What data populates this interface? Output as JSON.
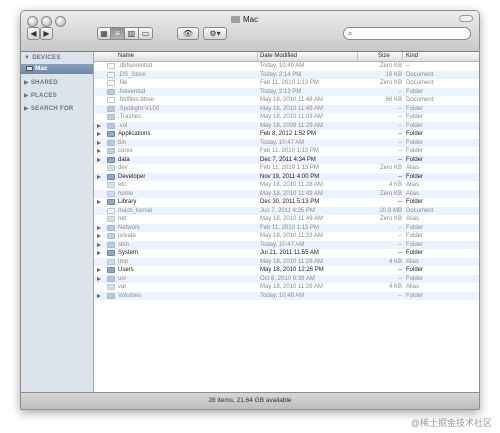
{
  "window": {
    "title": "Mac",
    "search_placeholder": "",
    "status_text": "28 items, 21.64 GB available"
  },
  "sidebar": {
    "sections": [
      {
        "label": "▼ DEVICES"
      },
      {
        "label": "▶ SHARED"
      },
      {
        "label": "▶ PLACES"
      },
      {
        "label": "▶ SEARCH FOR"
      }
    ],
    "selected_item": "Mac"
  },
  "columns": {
    "name": "Name",
    "date": "Date Modified",
    "size": "Size",
    "kind": "Kind"
  },
  "files": [
    {
      "name": ".dbfseventsd",
      "date": "Today, 10:49 AM",
      "size": "Zero KB",
      "kind": "--",
      "icon": "doc",
      "disclosure": false,
      "dim": true
    },
    {
      "name": ".DS_Store",
      "date": "Today, 2:14 PM",
      "size": "16 KB",
      "kind": "Document",
      "icon": "doc",
      "disclosure": false,
      "dim": true
    },
    {
      "name": ".file",
      "date": "Feb 11, 2010 1:13 PM",
      "size": "Zero KB",
      "kind": "Document",
      "icon": "doc",
      "disclosure": false,
      "dim": true
    },
    {
      "name": ".fseventsd",
      "date": "Today, 2:13 PM",
      "size": "--",
      "kind": "Folder",
      "icon": "folder",
      "disclosure": false,
      "dim": true
    },
    {
      "name": ".hotfiles.btree",
      "date": "May 18, 2010 11:48 AM",
      "size": "66 KB",
      "kind": "Document",
      "icon": "doc",
      "disclosure": false,
      "dim": true
    },
    {
      "name": ".Spotlight-V100",
      "date": "May 18, 2010 11:49 AM",
      "size": "--",
      "kind": "Folder",
      "icon": "folder",
      "disclosure": false,
      "dim": true
    },
    {
      "name": ".Trashes",
      "date": "May 18, 2010 11:03 AM",
      "size": "--",
      "kind": "Folder",
      "icon": "folder",
      "disclosure": false,
      "dim": true
    },
    {
      "name": ".vol",
      "date": "May 18, 2009 11:29 AM",
      "size": "--",
      "kind": "Folder",
      "icon": "folder",
      "disclosure": true,
      "dim": true
    },
    {
      "name": "Applications",
      "date": "Feb 8, 2012 1:52 PM",
      "size": "--",
      "kind": "Folder",
      "icon": "folder",
      "disclosure": true,
      "dim": false
    },
    {
      "name": "bin",
      "date": "Today, 10:47 AM",
      "size": "--",
      "kind": "Folder",
      "icon": "folder",
      "disclosure": true,
      "dim": true
    },
    {
      "name": "cores",
      "date": "Feb 11, 2010 1:13 PM",
      "size": "--",
      "kind": "Folder",
      "icon": "folder",
      "disclosure": true,
      "dim": true
    },
    {
      "name": "data",
      "date": "Dec 7, 2011 4:34 PM",
      "size": "--",
      "kind": "Folder",
      "icon": "folder",
      "disclosure": true,
      "dim": false
    },
    {
      "name": "dev",
      "date": "Feb 11, 2010 1:13 PM",
      "size": "Zero KB",
      "kind": "Alias",
      "icon": "alias",
      "disclosure": false,
      "dim": true
    },
    {
      "name": "Developer",
      "date": "Nov 19, 2011 4:00 PM",
      "size": "--",
      "kind": "Folder",
      "icon": "folder",
      "disclosure": true,
      "dim": false
    },
    {
      "name": "etc",
      "date": "May 18, 2010 11:28 AM",
      "size": "4 KB",
      "kind": "Alias",
      "icon": "alias",
      "disclosure": false,
      "dim": true
    },
    {
      "name": "home",
      "date": "May 18, 2010 11:49 AM",
      "size": "Zero KB",
      "kind": "Alias",
      "icon": "alias",
      "disclosure": false,
      "dim": true
    },
    {
      "name": "Library",
      "date": "Dec 30, 2011 5:13 PM",
      "size": "--",
      "kind": "Folder",
      "icon": "folder",
      "disclosure": true,
      "dim": false
    },
    {
      "name": "mach_kernel",
      "date": "Jun 7, 2011 4:35 PM",
      "size": "20.8 MB",
      "kind": "Document",
      "icon": "doc",
      "disclosure": false,
      "dim": true
    },
    {
      "name": "net",
      "date": "May 18, 2010 11:49 AM",
      "size": "Zero KB",
      "kind": "Alias",
      "icon": "alias",
      "disclosure": false,
      "dim": true
    },
    {
      "name": "Network",
      "date": "Feb 11, 2010 1:13 PM",
      "size": "--",
      "kind": "Folder",
      "icon": "folder",
      "disclosure": true,
      "dim": true
    },
    {
      "name": "private",
      "date": "May 18, 2010 11:33 AM",
      "size": "--",
      "kind": "Folder",
      "icon": "folder",
      "disclosure": true,
      "dim": true
    },
    {
      "name": "sbin",
      "date": "Today, 10:47 AM",
      "size": "--",
      "kind": "Folder",
      "icon": "folder",
      "disclosure": true,
      "dim": true
    },
    {
      "name": "System",
      "date": "Jul 21, 2011 11:55 AM",
      "size": "--",
      "kind": "Folder",
      "icon": "folder",
      "disclosure": true,
      "dim": false
    },
    {
      "name": "tmp",
      "date": "May 18, 2010 11:28 AM",
      "size": "4 KB",
      "kind": "Alias",
      "icon": "alias",
      "disclosure": false,
      "dim": true
    },
    {
      "name": "Users",
      "date": "May 18, 2010 12:26 PM",
      "size": "--",
      "kind": "Folder",
      "icon": "folder",
      "disclosure": true,
      "dim": false
    },
    {
      "name": "usr",
      "date": "Oct 6, 2010 9:39 AM",
      "size": "--",
      "kind": "Folder",
      "icon": "folder",
      "disclosure": true,
      "dim": true
    },
    {
      "name": "var",
      "date": "May 18, 2010 11:28 AM",
      "size": "4 KB",
      "kind": "Alias",
      "icon": "alias",
      "disclosure": false,
      "dim": true
    },
    {
      "name": "Volumes",
      "date": "Today, 10:48 AM",
      "size": "--",
      "kind": "Folder",
      "icon": "folder",
      "disclosure": true,
      "dim": true
    }
  ],
  "watermark": "@稀土掘金技术社区"
}
